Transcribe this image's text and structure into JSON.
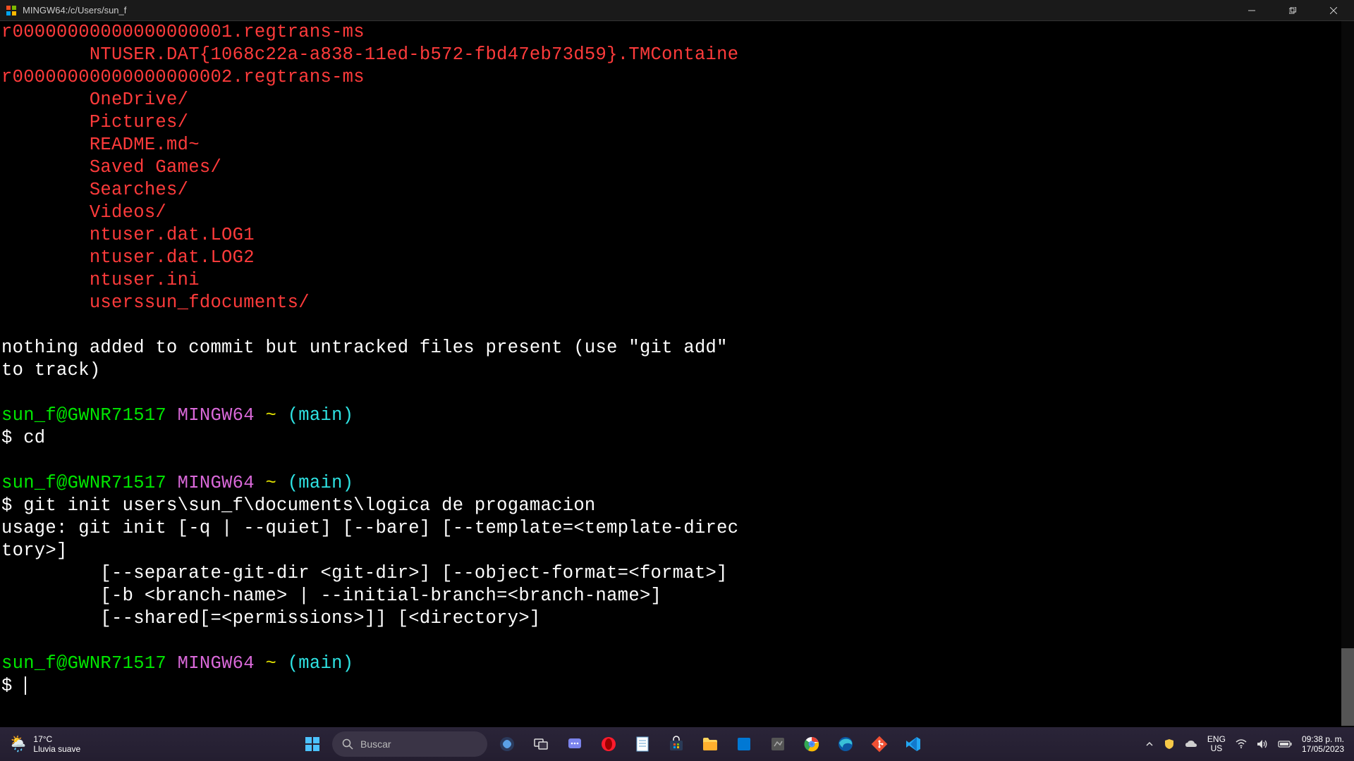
{
  "window": {
    "title": "MINGW64:/c/Users/sun_f"
  },
  "terminal": {
    "red_lines": [
      "r00000000000000000001.regtrans-ms",
      "        NTUSER.DAT{1068c22a-a838-11ed-b572-fbd47eb73d59}.TMContaine",
      "r00000000000000000002.regtrans-ms",
      "        OneDrive/",
      "        Pictures/",
      "        README.md~",
      "        Saved Games/",
      "        Searches/",
      "        Videos/",
      "        ntuser.dat.LOG1",
      "        ntuser.dat.LOG2",
      "        ntuser.ini",
      "        userssun_fdocuments/"
    ],
    "status_line1": "nothing added to commit but untracked files present (use \"git add\"",
    "status_line2": "to track)",
    "prompt": {
      "user": "sun_f@GWNR71517",
      "env": "MINGW64",
      "path": "~",
      "branch": "(main)"
    },
    "cmd1": "$ cd",
    "cmd2": "$ git init users\\sun_f\\documents\\logica de progamacion",
    "usage1": "usage: git init [-q | --quiet] [--bare] [--template=<template-direc",
    "usage2": "tory>]",
    "usage3": "         [--separate-git-dir <git-dir>] [--object-format=<format>]",
    "usage4": "         [-b <branch-name> | --initial-branch=<branch-name>]",
    "usage5": "         [--shared[=<permissions>]] [<directory>]",
    "last_prompt": "$ "
  },
  "taskbar": {
    "weather": {
      "temp": "17°C",
      "desc": "Lluvia suave"
    },
    "search_placeholder": "Buscar",
    "lang1": "ENG",
    "lang2": "US",
    "time": "09:38 p. m.",
    "date": "17/05/2023"
  }
}
